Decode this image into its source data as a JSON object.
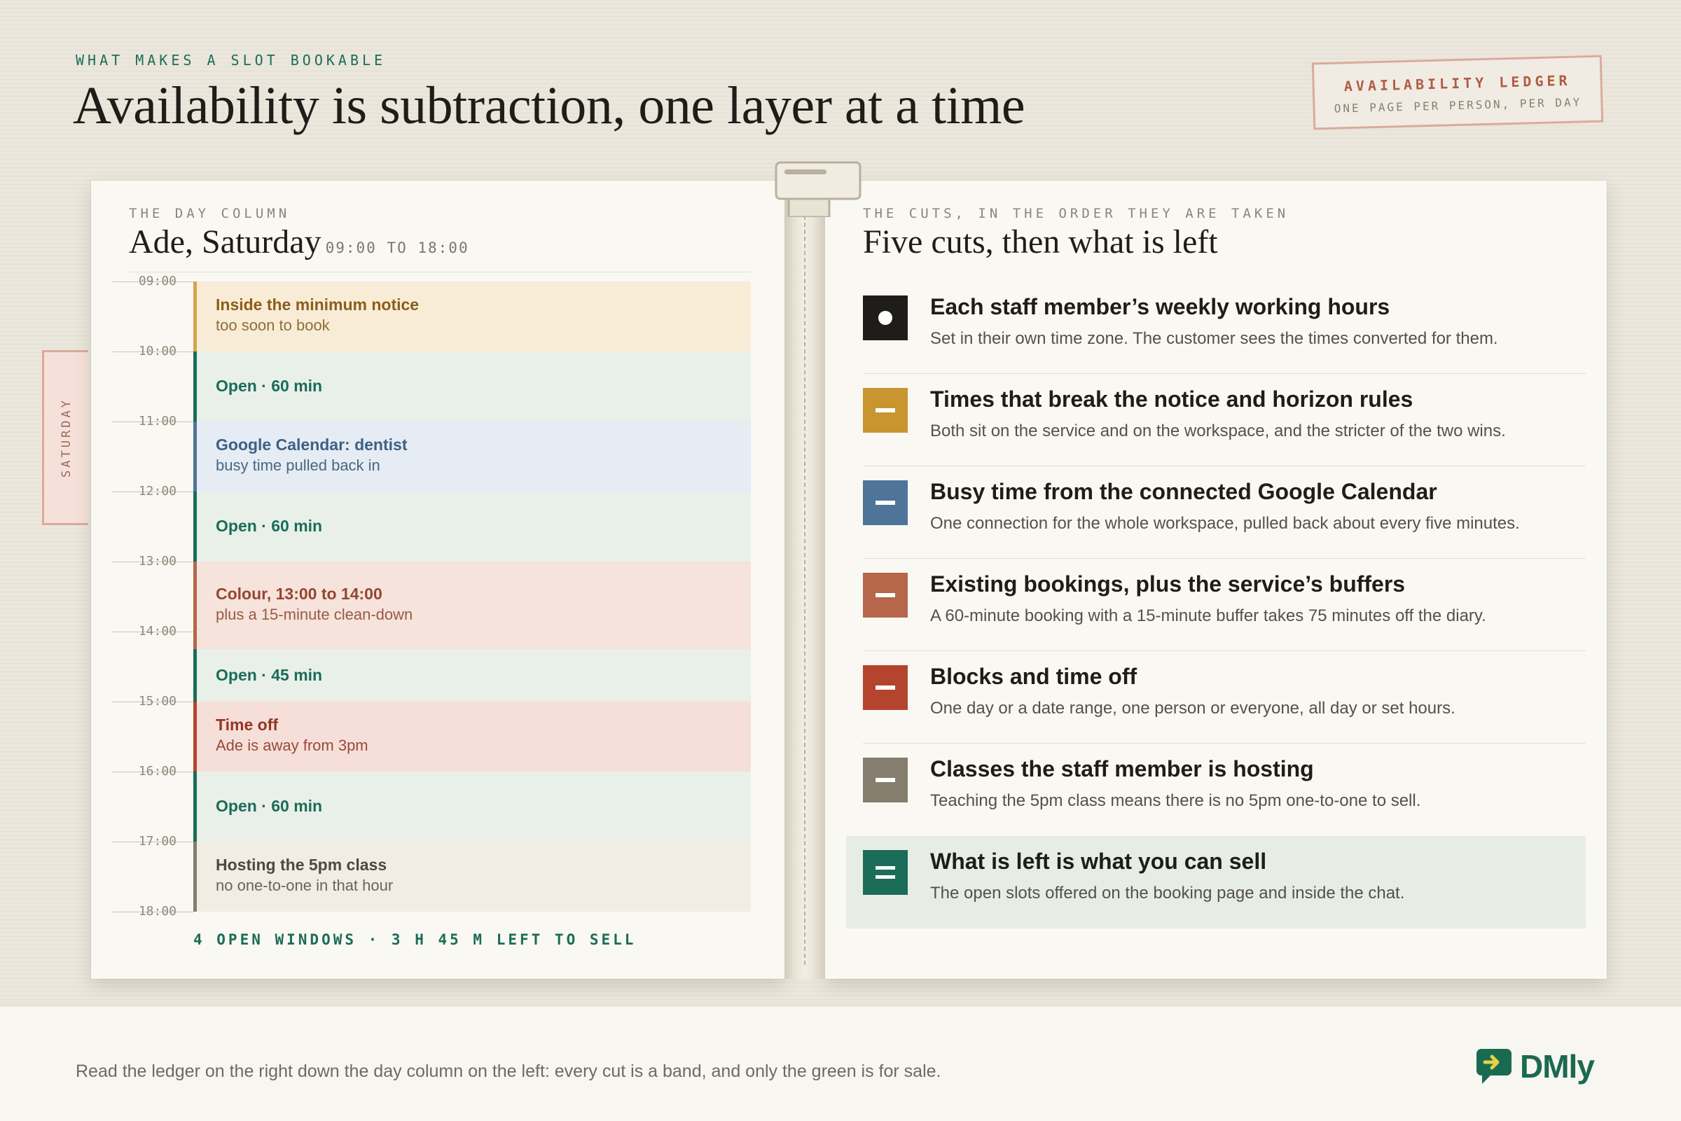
{
  "header": {
    "eyebrow": "WHAT MAKES A SLOT BOOKABLE",
    "title": "Availability is subtraction, one layer at a time",
    "stamp_title": "AVAILABILITY LEDGER",
    "stamp_subtitle": "ONE PAGE PER PERSON, PER DAY"
  },
  "day_column": {
    "label": "THE DAY COLUMN",
    "title": "Ade, Saturday",
    "range": "09:00 TO 18:00",
    "tab_label": "SATURDAY",
    "ticks": [
      "09:00",
      "10:00",
      "11:00",
      "12:00",
      "13:00",
      "14:00",
      "15:00",
      "16:00",
      "17:00",
      "18:00"
    ],
    "bands": [
      {
        "title": "Inside the minimum notice",
        "subtitle": "too soon to book"
      },
      {
        "title": "Open · 60 min",
        "subtitle": ""
      },
      {
        "title": "Google Calendar: dentist",
        "subtitle": "busy time pulled back in"
      },
      {
        "title": "Open · 60 min",
        "subtitle": ""
      },
      {
        "title": "Colour, 13:00 to 14:00",
        "subtitle": "plus a 15-minute clean-down"
      },
      {
        "title": "Open · 45 min",
        "subtitle": ""
      },
      {
        "title": "Time off",
        "subtitle": "Ade is away from 3pm"
      },
      {
        "title": "Open · 60 min",
        "subtitle": ""
      },
      {
        "title": "Hosting the 5pm class",
        "subtitle": "no one-to-one in that hour"
      }
    ],
    "summary": "4 OPEN WINDOWS · 3 H 45 M LEFT TO SELL"
  },
  "cuts": {
    "label": "THE CUTS, IN THE ORDER THEY ARE TAKEN",
    "title": "Five cuts, then what is left",
    "items": [
      {
        "title": "Each staff member’s weekly working hours",
        "body": "Set in their own time zone. The customer sees the times converted for them.",
        "color": "#1f1d19",
        "icon": "dot-icon"
      },
      {
        "title": "Times that break the notice and horizon rules",
        "body": "Both sit on the service and on the workspace, and the stricter of the two wins.",
        "color": "#c9952f",
        "icon": "minus-icon"
      },
      {
        "title": "Busy time from the connected Google Calendar",
        "body": "One connection for the whole workspace, pulled back about every five minutes.",
        "color": "#4e7499",
        "icon": "minus-icon"
      },
      {
        "title": "Existing bookings, plus the service’s buffers",
        "body": "A 60-minute booking with a 15-minute buffer takes 75 minutes off the diary.",
        "color": "#b5664b",
        "icon": "minus-icon"
      },
      {
        "title": "Blocks and time off",
        "body": "One day or a date range, one person or everyone, all day or set hours.",
        "color": "#b5442f",
        "icon": "minus-icon"
      },
      {
        "title": "Classes the staff member is hosting",
        "body": "Teaching the 5pm class means there is no 5pm one-to-one to sell.",
        "color": "#857d6e",
        "icon": "minus-icon"
      },
      {
        "title": "What is left is what you can sell",
        "body": "The open slots offered on the booking page and inside the chat.",
        "color": "#1b6c58",
        "icon": "equals-icon"
      }
    ]
  },
  "footer": {
    "note": "Read the ledger on the right down the day column on the left: every cut is a band, and only the green is for sale.",
    "logo_text": "DMly"
  }
}
